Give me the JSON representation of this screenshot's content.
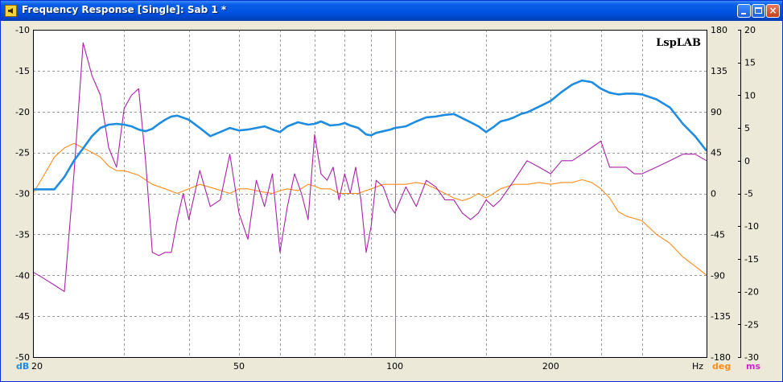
{
  "window": {
    "title": "Frequency Response [Single]: Sab 1 *",
    "controls": {
      "minimize": "minimize-icon",
      "maximize": "maximize-icon",
      "close": "close-icon"
    },
    "close_glyph": "×"
  },
  "chart_data": {
    "type": "line",
    "watermark": "LspLAB",
    "x_scale": "log",
    "xlim": [
      20,
      400
    ],
    "x_ticks": [
      20,
      50,
      100,
      200
    ],
    "x_unit": "Hz",
    "grid": true,
    "axes": {
      "left": {
        "unit": "dB",
        "ylim": [
          -50,
          -10
        ],
        "ticks": [
          -10,
          -15,
          -20,
          -25,
          -30,
          -35,
          -40,
          -45,
          -50
        ],
        "color": "#1E8CE0"
      },
      "right1": {
        "unit": "deg",
        "ylim": [
          -180,
          180
        ],
        "ticks": [
          180,
          135,
          90,
          45,
          0,
          -45,
          -90,
          -135,
          -180
        ],
        "color": "#FF8C1A"
      },
      "right2": {
        "unit": "ms",
        "ylim": [
          -30,
          20
        ],
        "ticks": [
          20,
          15,
          10,
          5,
          0,
          -5,
          -10,
          -15,
          -20,
          -25,
          -30
        ],
        "color": "#CC22CC"
      }
    },
    "series": [
      {
        "axis": "left",
        "color": "#1E8CE0",
        "x": [
          20,
          21,
          22,
          23,
          24,
          25,
          26,
          27,
          28,
          29,
          30,
          31,
          32,
          33,
          34,
          35,
          36,
          37,
          38,
          40,
          42,
          44,
          46,
          48,
          50,
          52,
          54,
          56,
          58,
          60,
          62,
          65,
          68,
          70,
          72,
          75,
          78,
          80,
          82,
          85,
          88,
          90,
          92,
          95,
          98,
          100,
          105,
          110,
          115,
          120,
          125,
          130,
          135,
          140,
          145,
          150,
          155,
          160,
          165,
          170,
          175,
          180,
          190,
          200,
          210,
          220,
          230,
          240,
          250,
          260,
          270,
          280,
          290,
          300,
          320,
          340,
          360,
          380,
          400
        ],
        "y": [
          -29.5,
          -29.5,
          -29.5,
          -28,
          -26,
          -24.5,
          -23,
          -22,
          -21.6,
          -21.5,
          -21.6,
          -21.8,
          -22.2,
          -22.4,
          -22.1,
          -21.5,
          -21,
          -20.6,
          -20.5,
          -21,
          -22,
          -23,
          -22.5,
          -22,
          -22.3,
          -22.2,
          -22,
          -21.8,
          -22.2,
          -22.5,
          -21.8,
          -21.3,
          -21.6,
          -21.5,
          -21.2,
          -21.7,
          -21.6,
          -21.4,
          -21.7,
          -22,
          -22.8,
          -22.9,
          -22.6,
          -22.4,
          -22.2,
          -22,
          -21.8,
          -21.2,
          -20.7,
          -20.6,
          -20.4,
          -20.3,
          -20.8,
          -21.3,
          -21.8,
          -22.5,
          -21.9,
          -21.2,
          -21,
          -20.7,
          -20.3,
          -20.1,
          -19.4,
          -18.7,
          -17.6,
          -16.7,
          -16.2,
          -16.4,
          -17.2,
          -17.7,
          -17.9,
          -17.8,
          -17.8,
          -17.9,
          -18.5,
          -19.5,
          -21.5,
          -23,
          -24.8
        ]
      },
      {
        "axis": "right1",
        "color": "#FF8C1A",
        "x": [
          20,
          21,
          22,
          23,
          24,
          25,
          26,
          27,
          28,
          29,
          30,
          32,
          34,
          36,
          38,
          40,
          42,
          45,
          48,
          50,
          52,
          55,
          58,
          60,
          62,
          65,
          68,
          70,
          72,
          75,
          78,
          80,
          85,
          90,
          95,
          100,
          105,
          110,
          115,
          120,
          125,
          130,
          135,
          140,
          145,
          150,
          155,
          160,
          170,
          180,
          190,
          200,
          210,
          220,
          230,
          240,
          250,
          260,
          270,
          280,
          300,
          320,
          340,
          360,
          380,
          400
        ],
        "y": [
          0,
          20,
          40,
          50,
          55,
          50,
          45,
          40,
          30,
          25,
          25,
          20,
          10,
          5,
          0,
          5,
          10,
          5,
          0,
          5,
          5,
          2,
          0,
          3,
          5,
          3,
          10,
          8,
          5,
          5,
          0,
          0,
          0,
          5,
          10,
          10,
          10,
          12,
          10,
          5,
          0,
          -5,
          -8,
          -5,
          0,
          -5,
          0,
          5,
          10,
          10,
          12,
          10,
          12,
          12,
          15,
          12,
          5,
          -5,
          -20,
          -25,
          -30,
          -45,
          -55,
          -70,
          -80,
          -90
        ]
      },
      {
        "axis": "right2",
        "color": "#AA22AA",
        "x": [
          20,
          21,
          22,
          23,
          24,
          25,
          26,
          27,
          28,
          29,
          30,
          31,
          32,
          33,
          34,
          35,
          36,
          37,
          38,
          39,
          40,
          42,
          44,
          46,
          48,
          50,
          52,
          54,
          56,
          58,
          60,
          62,
          64,
          66,
          68,
          70,
          72,
          74,
          76,
          78,
          80,
          82,
          84,
          86,
          88,
          90,
          92,
          95,
          98,
          100,
          105,
          110,
          115,
          120,
          125,
          130,
          135,
          140,
          145,
          150,
          155,
          160,
          170,
          180,
          190,
          200,
          210,
          220,
          230,
          240,
          250,
          260,
          270,
          280,
          290,
          300,
          320,
          340,
          360,
          380,
          400
        ],
        "y": [
          -17,
          -18,
          -19,
          -20,
          -2,
          18,
          13,
          10,
          2,
          -1,
          8,
          10,
          11,
          0,
          -14,
          -14.5,
          -14,
          -14,
          -9,
          -5,
          -9,
          -1.5,
          -7,
          -6,
          1,
          -8,
          -12,
          -3,
          -7,
          -2,
          -14,
          -7,
          -2,
          -5,
          -9,
          4,
          -2,
          -3,
          -1,
          -6,
          -2,
          -5,
          -1,
          -6,
          -14,
          -10,
          -3,
          -4,
          -7,
          -8,
          -4,
          -7,
          -3,
          -4,
          -6,
          -6,
          -8,
          -9,
          -8,
          -6,
          -7,
          -6,
          -3,
          0,
          -1,
          -2,
          0,
          0,
          1,
          2,
          3,
          -1,
          -1,
          -1,
          -2,
          -2,
          -1,
          0,
          1,
          1,
          0
        ]
      }
    ],
    "readout": {
      "dB": "dB",
      "x": "Hz",
      "deg": "deg",
      "ms": "ms"
    }
  }
}
